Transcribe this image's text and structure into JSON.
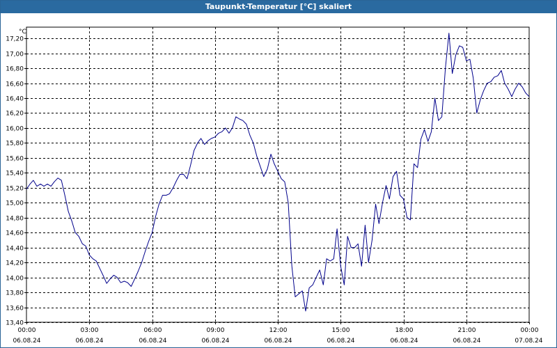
{
  "window": {
    "title": "Taupunkt-Temperatur [°C] skaliert"
  },
  "chart_data": {
    "type": "line",
    "title": "Taupunkt-Temperatur [°C] skaliert",
    "ylabel": "°C",
    "xlabel": "",
    "ylim": [
      13.4,
      17.35
    ],
    "xlim_hours": [
      0,
      24
    ],
    "grid": true,
    "y_ticks": [
      "13,40",
      "13,60",
      "13,80",
      "14,00",
      "14,20",
      "14,40",
      "14,60",
      "14,80",
      "15,00",
      "15,20",
      "15,40",
      "15,60",
      "15,80",
      "16,00",
      "16,20",
      "16,40",
      "16,60",
      "16,80",
      "17,00",
      "17,20"
    ],
    "x_ticks": [
      {
        "time": "00:00",
        "date": "06.08.24"
      },
      {
        "time": "03:00",
        "date": "06.08.24"
      },
      {
        "time": "06:00",
        "date": "06.08.24"
      },
      {
        "time": "09:00",
        "date": "06.08.24"
      },
      {
        "time": "12:00",
        "date": "06.08.24"
      },
      {
        "time": "15:00",
        "date": "06.08.24"
      },
      {
        "time": "18:00",
        "date": "06.08.24"
      },
      {
        "time": "21:00",
        "date": "06.08.24"
      },
      {
        "time": "00:00",
        "date": "07.08.24"
      }
    ],
    "series": [
      {
        "color": "#00008b",
        "x_hours": [
          0.0,
          0.17,
          0.33,
          0.5,
          0.67,
          0.83,
          1.0,
          1.17,
          1.33,
          1.5,
          1.67,
          1.83,
          2.0,
          2.17,
          2.33,
          2.5,
          2.67,
          2.83,
          3.0,
          3.17,
          3.33,
          3.5,
          3.67,
          3.83,
          4.0,
          4.17,
          4.33,
          4.5,
          4.67,
          4.83,
          5.0,
          5.17,
          5.33,
          5.5,
          5.67,
          5.83,
          6.0,
          6.17,
          6.33,
          6.5,
          6.67,
          6.83,
          7.0,
          7.17,
          7.33,
          7.5,
          7.67,
          7.83,
          8.0,
          8.17,
          8.33,
          8.5,
          8.67,
          8.83,
          9.0,
          9.17,
          9.33,
          9.5,
          9.67,
          9.83,
          10.0,
          10.17,
          10.33,
          10.5,
          10.67,
          10.83,
          11.0,
          11.17,
          11.33,
          11.5,
          11.67,
          11.83,
          12.0,
          12.17,
          12.33,
          12.5,
          12.67,
          12.83,
          13.0,
          13.17,
          13.33,
          13.5,
          13.67,
          13.83,
          14.0,
          14.17,
          14.33,
          14.5,
          14.67,
          14.83,
          15.0,
          15.17,
          15.33,
          15.5,
          15.67,
          15.83,
          16.0,
          16.17,
          16.33,
          16.5,
          16.67,
          16.83,
          17.0,
          17.17,
          17.33,
          17.5,
          17.67,
          17.83,
          18.0,
          18.17,
          18.33,
          18.5,
          18.67,
          18.83,
          19.0,
          19.17,
          19.33,
          19.5,
          19.67,
          19.83,
          20.0,
          20.17,
          20.33,
          20.5,
          20.67,
          20.83,
          21.0,
          21.17,
          21.33,
          21.5,
          21.67,
          21.83,
          22.0,
          22.17,
          22.33,
          22.5,
          22.67,
          22.83,
          23.0,
          23.17,
          23.33,
          23.5,
          23.67,
          23.83,
          24.0
        ],
        "values": [
          15.18,
          15.25,
          15.3,
          15.22,
          15.25,
          15.22,
          15.25,
          15.22,
          15.28,
          15.33,
          15.3,
          15.1,
          14.88,
          14.75,
          14.6,
          14.55,
          14.45,
          14.42,
          14.3,
          14.25,
          14.22,
          14.12,
          14.02,
          13.92,
          13.98,
          14.03,
          14.0,
          13.93,
          13.95,
          13.93,
          13.88,
          13.98,
          14.08,
          14.2,
          14.35,
          14.48,
          14.6,
          14.82,
          14.98,
          15.1,
          15.1,
          15.12,
          15.2,
          15.3,
          15.38,
          15.38,
          15.32,
          15.5,
          15.7,
          15.8,
          15.86,
          15.78,
          15.83,
          15.86,
          15.88,
          15.93,
          15.95,
          16.0,
          15.93,
          16.0,
          16.15,
          16.12,
          16.1,
          16.05,
          15.9,
          15.8,
          15.62,
          15.48,
          15.35,
          15.45,
          15.65,
          15.52,
          15.42,
          15.32,
          15.28,
          15.0,
          14.15,
          13.74,
          13.78,
          13.82,
          13.55,
          13.86,
          13.9,
          14.0,
          14.1,
          13.9,
          14.25,
          14.22,
          14.25,
          14.65,
          14.15,
          13.9,
          14.55,
          14.4,
          14.4,
          14.45,
          14.15,
          14.7,
          14.2,
          14.5,
          14.98,
          14.72,
          15.0,
          15.23,
          15.05,
          15.35,
          15.42,
          15.1,
          15.05,
          14.8,
          14.77,
          15.52,
          15.47,
          15.85,
          15.98,
          15.82,
          15.95,
          16.4,
          16.1,
          16.15,
          16.8,
          17.27,
          16.73,
          16.98,
          17.1,
          17.08,
          16.9,
          16.92,
          16.67,
          16.2,
          16.38,
          16.5,
          16.6,
          16.62,
          16.68,
          16.7,
          16.77,
          16.6,
          16.52,
          16.42,
          16.52,
          16.6,
          16.55,
          16.47,
          16.42,
          16.45,
          16.4
        ]
      }
    ]
  }
}
